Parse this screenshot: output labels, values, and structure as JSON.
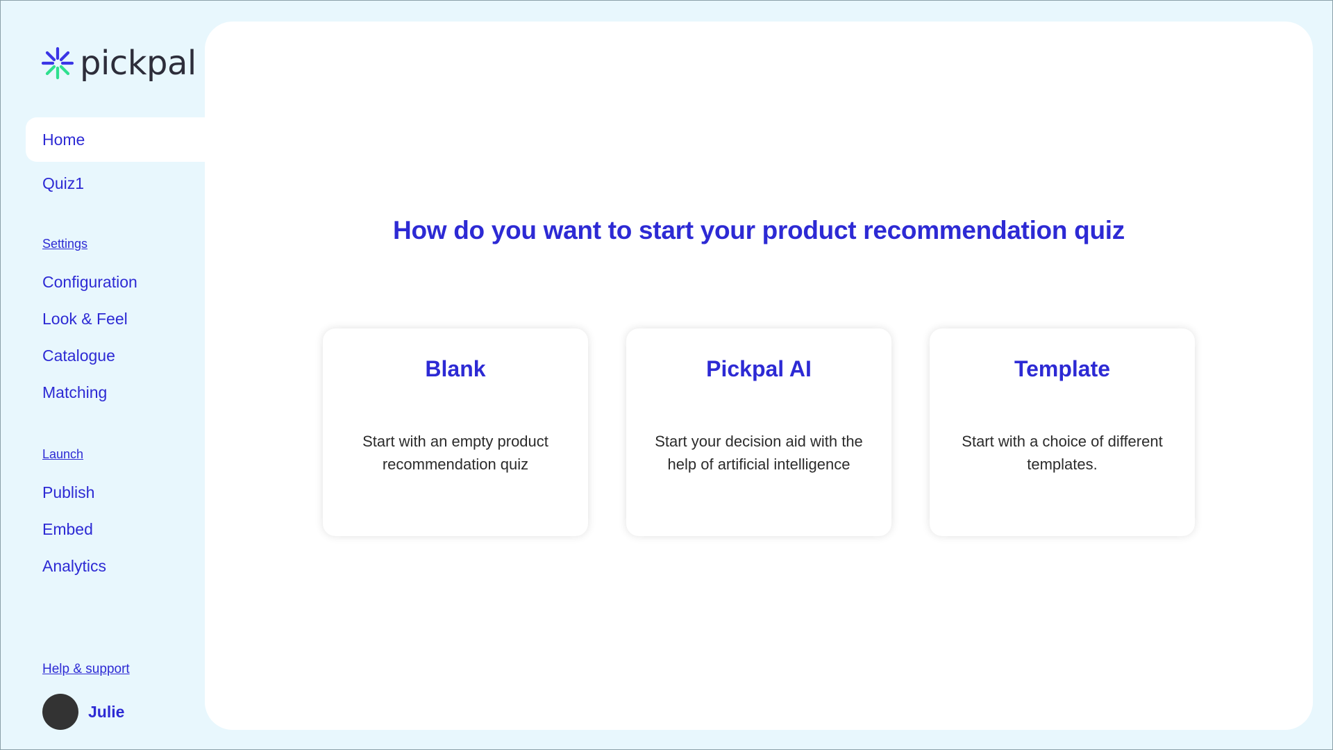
{
  "brand": {
    "name": "pickpal",
    "logo_icon": "pickpal-burst-icon",
    "colors": {
      "blue": "#3a35e6",
      "green": "#2fe08f"
    }
  },
  "nav": {
    "home": "Home",
    "quiz": "Quiz1"
  },
  "settings": {
    "label": "Settings",
    "items": [
      "Configuration",
      "Look & Feel",
      "Catalogue",
      "Matching"
    ]
  },
  "launch": {
    "label": "Launch",
    "items": [
      "Publish",
      "Embed",
      "Analytics"
    ]
  },
  "footer": {
    "help": "Help & support",
    "user_name": "Julie"
  },
  "main": {
    "heading": "How do you want to start your product recommendation quiz",
    "cards": [
      {
        "title": "Blank",
        "description": "Start with an empty product recommendation quiz"
      },
      {
        "title": "Pickpal AI",
        "description": "Start your decision aid with the help of artificial intelligence"
      },
      {
        "title": "Template",
        "description": "Start with a choice of different templates."
      }
    ]
  },
  "theme": {
    "accent": "#2d2ad4",
    "sidebar_bg": "#e8f7fd",
    "panel_bg": "#ffffff"
  }
}
